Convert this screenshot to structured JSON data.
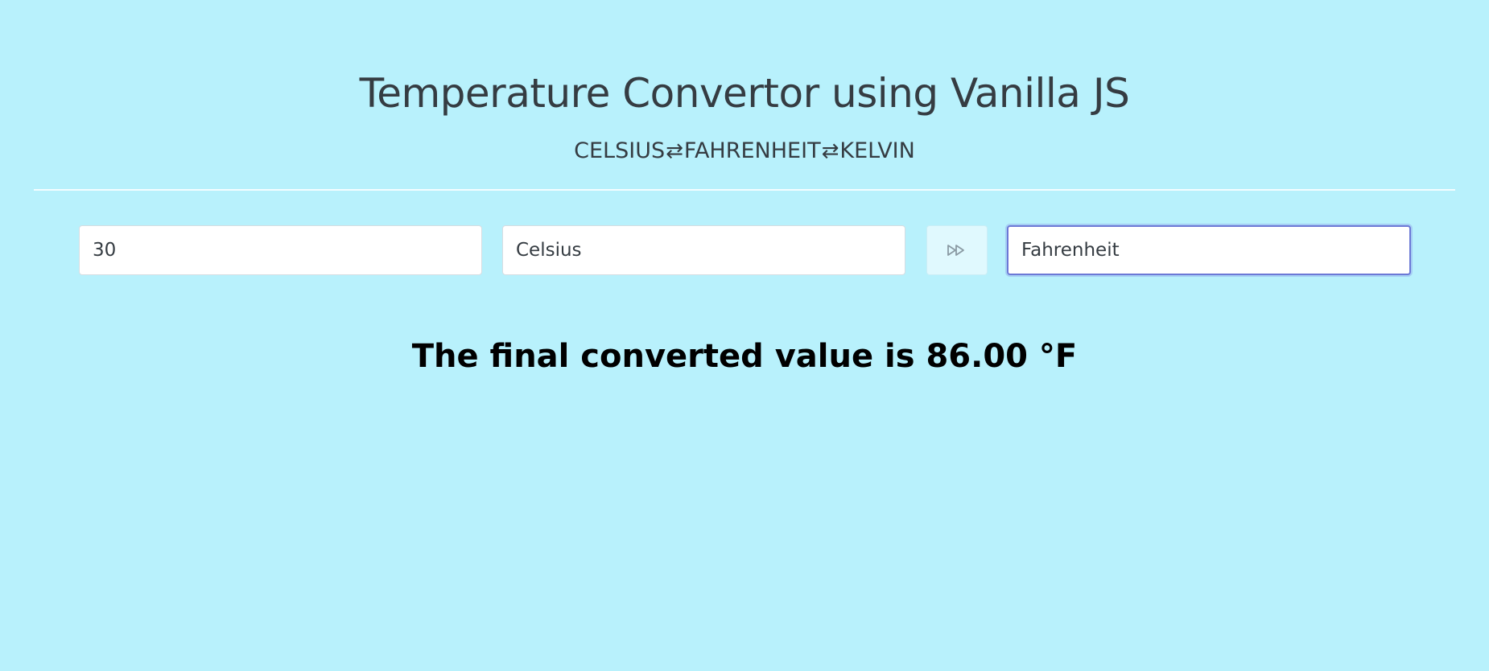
{
  "header": {
    "title": "Temperature Convertor using Vanilla JS",
    "units": [
      "CELSIUS",
      "FAHRENHEIT",
      "KELVIN"
    ],
    "separator_icon": "swap-arrows-icon"
  },
  "form": {
    "value_input": {
      "value": "30"
    },
    "from_unit": {
      "value": "Celsius"
    },
    "convert_button": {
      "icon": "fast-forward-icon"
    },
    "to_unit": {
      "value": "Fahrenheit",
      "focused": true
    }
  },
  "result": {
    "text": "The final converted value is 86.00 °F"
  },
  "colors": {
    "background": "#b8f1fc",
    "text": "#353c42",
    "focus_border": "#6c79d6",
    "button_bg": "#e0f9fe"
  }
}
